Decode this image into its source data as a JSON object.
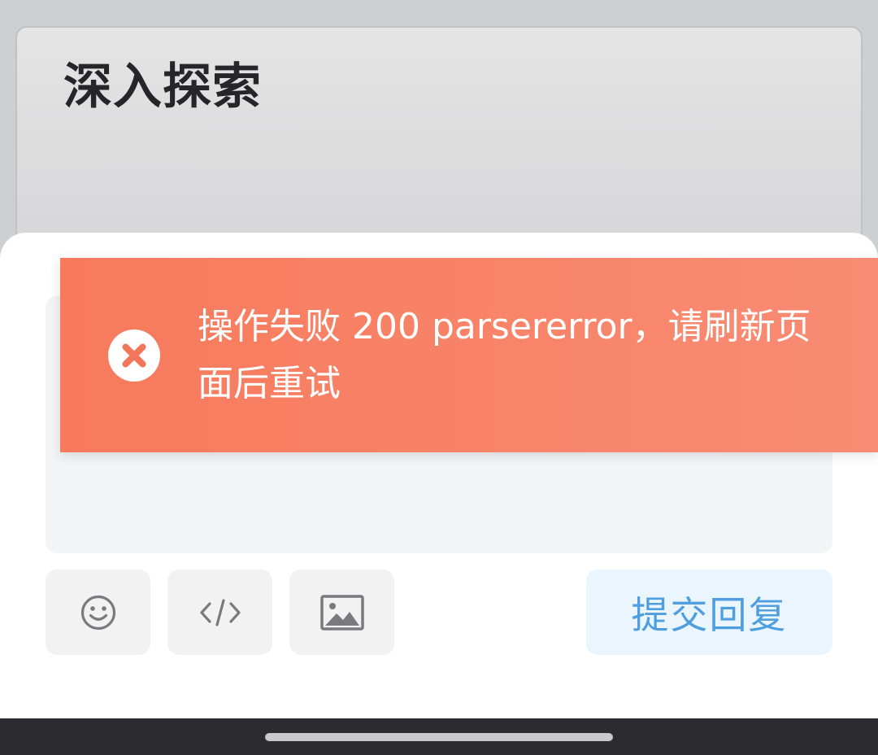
{
  "background": {
    "title": "深入探索"
  },
  "toast": {
    "message": "操作失败 200 parsererror，请刷新页面后重试",
    "icon": "error-circle-icon",
    "color": "#f77a5c"
  },
  "composer": {
    "tools": [
      {
        "name": "emoji",
        "icon": "smiley-icon"
      },
      {
        "name": "code",
        "icon": "code-icon"
      },
      {
        "name": "image",
        "icon": "image-icon"
      }
    ],
    "submit_label": "提交回复",
    "submit_color": "#4f9fe0"
  }
}
